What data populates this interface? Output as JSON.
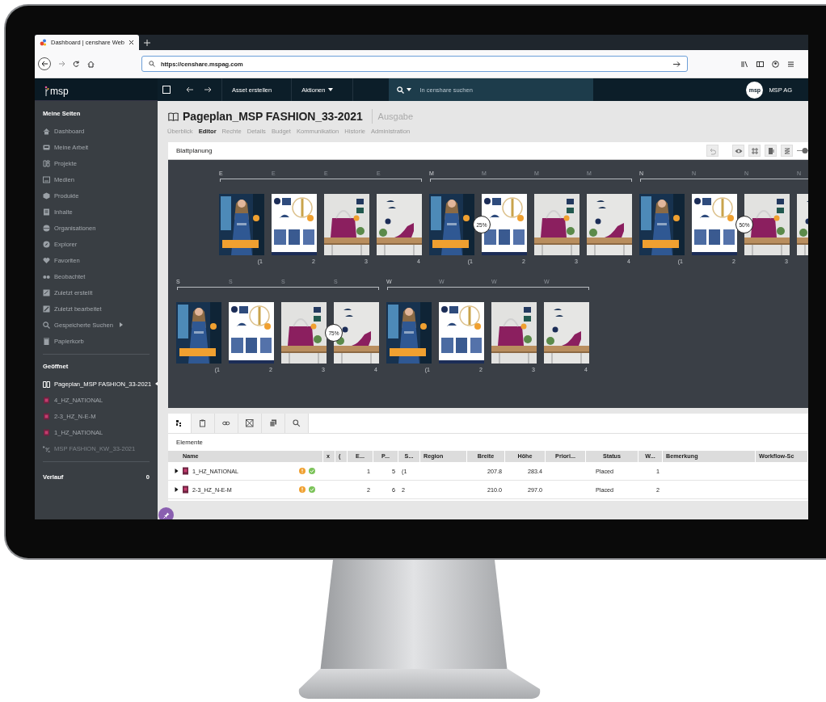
{
  "browser": {
    "tab_title": "Dashboard | censhare Web",
    "url": "https://censhare.mspag.com"
  },
  "app_bar": {
    "logo": "msp",
    "buttons": [
      "Asset erstellen",
      "Aktionen"
    ],
    "search": {
      "placeholder": "In censhare suchen"
    },
    "avatar": "msp",
    "account": "MSP AG"
  },
  "sidebar": {
    "sections": [
      {
        "title": "Meine Seiten",
        "items": [
          {
            "label": "Dashboard",
            "submenu": false
          },
          {
            "label": "Meine Arbeit",
            "submenu": false
          },
          {
            "label": "Projekte",
            "submenu": false
          },
          {
            "label": "Medien",
            "submenu": false
          },
          {
            "label": "Produkte",
            "submenu": false
          },
          {
            "label": "Inhalte",
            "submenu": false
          },
          {
            "label": "Organisationen",
            "submenu": false
          },
          {
            "label": "Explorer",
            "submenu": false
          },
          {
            "label": "Favoriten",
            "submenu": false
          },
          {
            "label": "Beobachtet",
            "submenu": false
          },
          {
            "label": "Zuletzt erstellt",
            "submenu": false
          },
          {
            "label": "Zuletzt bearbeitet",
            "submenu": false
          },
          {
            "label": "Gespeicherte Suchen",
            "submenu": true
          },
          {
            "label": "Papierkorb",
            "submenu": false
          }
        ]
      },
      {
        "title": "Geöffnet",
        "items": [
          {
            "label": "Pageplan_MSP FASHION_33-2021",
            "kind": "pageplan",
            "selected": true
          },
          {
            "label": "4_HZ_NATIONAL",
            "kind": "layout",
            "selected": false
          },
          {
            "label": "2-3_HZ_N-E-M",
            "kind": "layout",
            "selected": false
          },
          {
            "label": "1_HZ_NATIONAL",
            "kind": "layout",
            "selected": false
          },
          {
            "label": "MSP FASHION_KW_33-2021",
            "kind": "issue",
            "selected": false
          }
        ]
      }
    ],
    "history": {
      "title": "Verlauf",
      "count": "0"
    }
  },
  "page": {
    "title": "Pageplan_MSP FASHION_33-2021",
    "type": "Ausgabe",
    "tabs": [
      {
        "label": "Überblick",
        "selected": false
      },
      {
        "label": "Editor",
        "selected": true
      },
      {
        "label": "Rechte",
        "selected": false
      },
      {
        "label": "Details",
        "selected": false
      },
      {
        "label": "Budget",
        "selected": false
      },
      {
        "label": "Kommunikation",
        "selected": false
      },
      {
        "label": "Historie",
        "selected": false
      },
      {
        "label": "Administration",
        "selected": false
      }
    ]
  },
  "planning": {
    "title": "Blattplanung",
    "rows": [
      {
        "groups": [
          {
            "pages": [
              {
                "letter": "E",
                "number": "(1",
                "kind": "cover"
              },
              {
                "letter": "E",
                "number": "2",
                "kind": "catalog"
              },
              {
                "letter": "E",
                "number": "3",
                "kind": "bag"
              },
              {
                "letter": "E",
                "number": "4",
                "kind": "shoe"
              }
            ]
          },
          {
            "pages": [
              {
                "letter": "M",
                "number": "(1",
                "kind": "cover"
              },
              {
                "letter": "M",
                "number": "2",
                "kind": "catalog",
                "badge": "25%"
              },
              {
                "letter": "M",
                "number": "3",
                "kind": "bag"
              },
              {
                "letter": "M",
                "number": "4",
                "kind": "shoe"
              }
            ]
          },
          {
            "pages": [
              {
                "letter": "N",
                "number": "(1",
                "kind": "cover"
              },
              {
                "letter": "N",
                "number": "2",
                "kind": "catalog"
              },
              {
                "letter": "N",
                "number": "3",
                "kind": "bag",
                "badge": "50%"
              },
              {
                "letter": "N",
                "kind": "shoe"
              }
            ]
          }
        ]
      },
      {
        "groups": [
          {
            "pages": [
              {
                "letter": "S",
                "number": "(1",
                "kind": "cover"
              },
              {
                "letter": "S",
                "number": "2",
                "kind": "catalog"
              },
              {
                "letter": "S",
                "number": "3",
                "kind": "bag"
              },
              {
                "letter": "S",
                "number": "4",
                "kind": "shoe",
                "badge": "75%"
              }
            ]
          },
          {
            "pages": [
              {
                "letter": "W",
                "number": "(1",
                "kind": "cover"
              },
              {
                "letter": "W",
                "number": "2",
                "kind": "catalog"
              },
              {
                "letter": "W",
                "number": "3",
                "kind": "bag"
              },
              {
                "letter": "W",
                "number": "4",
                "kind": "shoe"
              }
            ]
          }
        ]
      }
    ]
  },
  "elements": {
    "tabs": [
      {
        "selected": true
      },
      {
        "selected": false
      },
      {
        "selected": false
      },
      {
        "selected": false
      },
      {
        "selected": false
      },
      {
        "selected": false
      }
    ],
    "title": "Elemente",
    "columns": [
      "Name",
      "x",
      "(",
      "E...",
      "P...",
      "S...",
      "Region",
      "Breite",
      "Höhe",
      "Priori...",
      "Status",
      "W...",
      "Bemerkung",
      "Workflow-Sc"
    ],
    "rows": [
      {
        "name": "1_HZ_NATIONAL",
        "expanded": false,
        "e": "1",
        "p": "5",
        "s": "(1",
        "breite": "207.8",
        "hoehe": "283.4",
        "status": "Placed",
        "w": "1"
      },
      {
        "name": "2-3_HZ_N-E-M",
        "expanded": false,
        "e": "2",
        "p": "6",
        "s": "2",
        "breite": "210.0",
        "hoehe": "297.0",
        "status": "Placed",
        "w": "2"
      }
    ]
  }
}
